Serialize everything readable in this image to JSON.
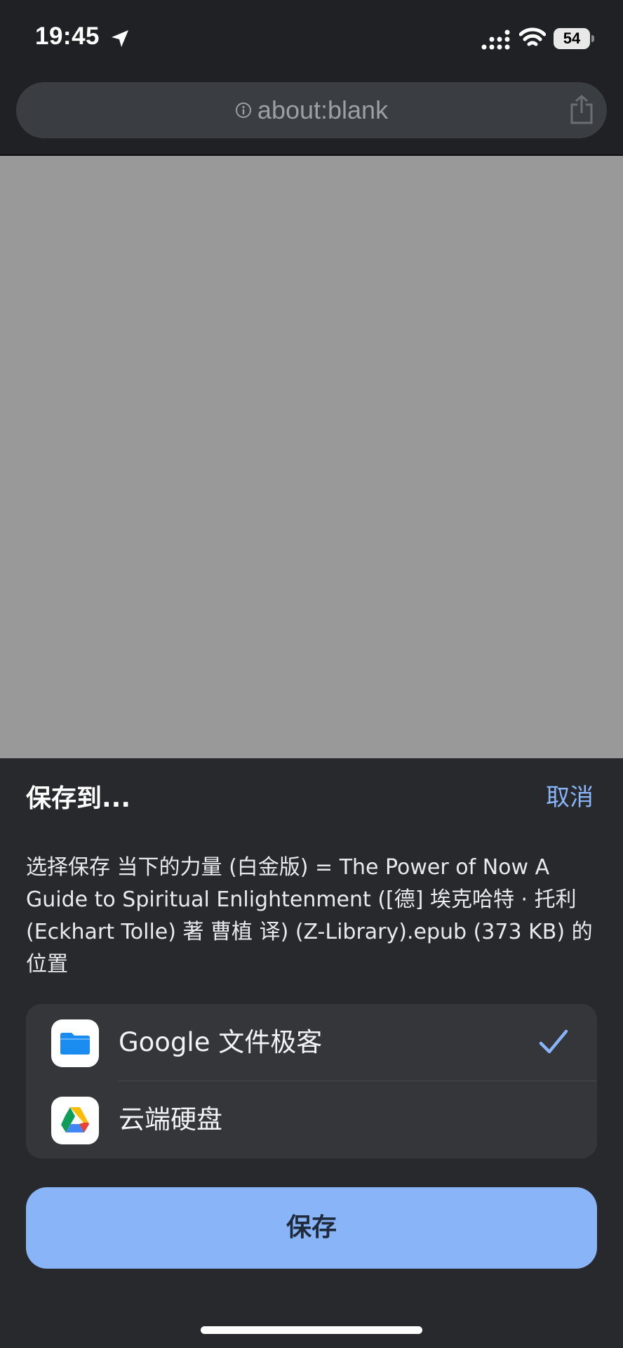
{
  "status_bar": {
    "time": "19:45",
    "battery": "54",
    "icons": [
      "location-arrow-icon",
      "signal-icon",
      "wifi-icon",
      "battery-icon"
    ]
  },
  "address_bar": {
    "url": "about:blank",
    "icons": [
      "info-icon",
      "share-icon"
    ]
  },
  "sheet": {
    "title": "保存到...",
    "cancel_label": "取消",
    "description": "选择保存 当下的力量 (白金版) = The Power of Now A Guide to Spiritual Enlightenment ([德] 埃克哈特 · 托利 (Eckhart Tolle) 著 曹植 译) (Z-Library).epub (373 KB) 的位置",
    "options": [
      {
        "label": "Google 文件极客",
        "icon": "folder-icon",
        "selected": true
      },
      {
        "label": "云端硬盘",
        "icon": "google-drive-icon",
        "selected": false
      }
    ],
    "save_label": "保存"
  },
  "colors": {
    "accent": "#8ab4f8",
    "sheet_background": "#28292c",
    "web_content": "#999999",
    "folder_blue": "#1a8cf0"
  }
}
